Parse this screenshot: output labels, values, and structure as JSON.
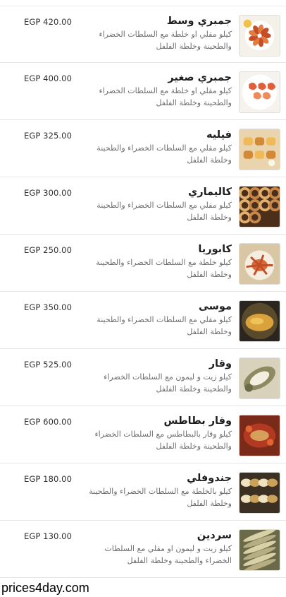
{
  "menu": {
    "items": [
      {
        "name": "جمبري وسط",
        "description": "كيلو مقلي او خلطة مع السلطات الخضراء والطحينة وخلطة الفلفل",
        "price": "EGP 420.00",
        "image_icon": "fried-shrimp-bowl-image",
        "colors": [
          "#f4f1ea",
          "#e27d3f",
          "#c64d26",
          "#f2c14a"
        ]
      },
      {
        "name": "جمبري صغير",
        "description": "كيلو مقلي او خلطة مع السلطات الخضراء والطحينة وخلطة الفلفل",
        "price": "EGP 400.00",
        "image_icon": "shrimp-plate-image",
        "colors": [
          "#f6f3ee",
          "#ee8a5c",
          "#e05e3c",
          "#ffffff"
        ]
      },
      {
        "name": "فيليه",
        "description": "كيلو مقلي مع السلطات الخضراء والطحينة وخلطة الفلفل",
        "price": "EGP 325.00",
        "image_icon": "fish-fillet-image",
        "colors": [
          "#e9d4ad",
          "#d28a36",
          "#f0b959",
          "#fbf6ea"
        ]
      },
      {
        "name": "كاليماري",
        "description": "كيلو مقلي مع السلطات الخضراء والطحينة وخلطة الفلفل",
        "price": "EGP 300.00",
        "image_icon": "calamari-image",
        "colors": [
          "#4c2f1b",
          "#c7874a",
          "#e2b06c",
          "#2a1a10"
        ]
      },
      {
        "name": "كابوريا",
        "description": "كيلو خلطة مع السلطات الخضراء والطحينة وخلطة الفلفل",
        "price": "EGP 250.00",
        "image_icon": "crab-plate-image",
        "colors": [
          "#d9c6a5",
          "#d56a3a",
          "#c14d26",
          "#f4ede0"
        ]
      },
      {
        "name": "موسى",
        "description": "كيلو مقلي مع السلطات الخضراء والطحينة وخلطة الفلفل",
        "price": "EGP 350.00",
        "image_icon": "sole-fish-pan-image",
        "colors": [
          "#2b2520",
          "#d9a23d",
          "#f0c35a",
          "#5a4a2c"
        ]
      },
      {
        "name": "وقار",
        "description": "كيلو زيت و ليمون مع السلطات الخضراء والطحينة وخلطة الفلفل",
        "price": "EGP 525.00",
        "image_icon": "grilled-fish-image",
        "colors": [
          "#d8d2bd",
          "#8d8a62",
          "#f3efe0",
          "#6b6a48"
        ]
      },
      {
        "name": "وقار بطاطس",
        "description": "كيلو وقار بالبطاطس مع السلطات الخضراء والطحينة وخلطة الفلفل",
        "price": "EGP 600.00",
        "image_icon": "fish-potato-tray-image",
        "colors": [
          "#b23a22",
          "#e0652f",
          "#d7a05a",
          "#7a2a18"
        ]
      },
      {
        "name": "جندوفلي",
        "description": "كيلو بالخلطة مع السلطات الخضراء والطحينة وخلطة الفلفل",
        "price": "EGP 180.00",
        "image_icon": "clams-bowl-image",
        "colors": [
          "#3b3022",
          "#c9a15a",
          "#efe2c0",
          "#6a5230"
        ]
      },
      {
        "name": "سردين",
        "description": "كيلو زيت و ليمون او مقلي مع السلطات الخضراء والطحينة وخلطة الفلفل",
        "price": "EGP 130.00",
        "image_icon": "sardines-image",
        "colors": [
          "#6a6a4a",
          "#b6ae82",
          "#4a4a34",
          "#d8d0a6"
        ]
      }
    ]
  },
  "watermark": "prices4day.com"
}
